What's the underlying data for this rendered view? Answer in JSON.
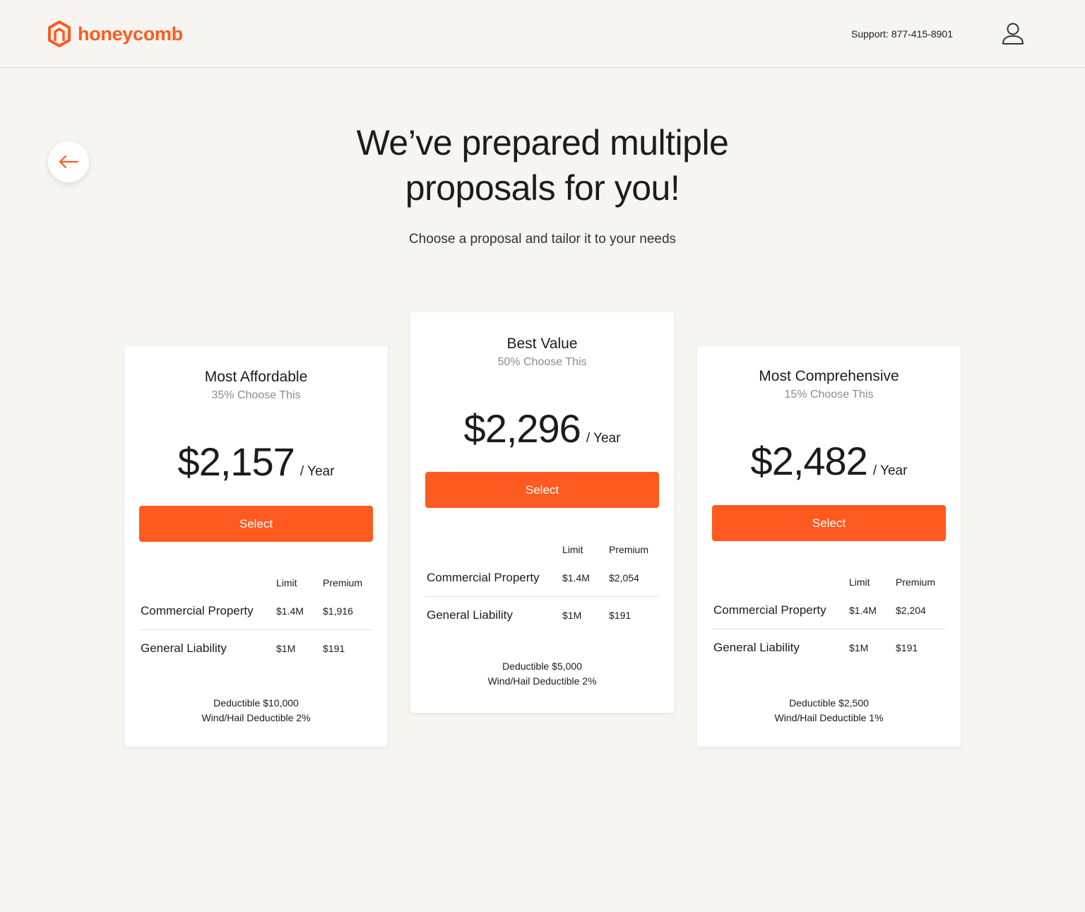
{
  "header": {
    "brand": "honeycomb",
    "support": "Support: 877-415-8901",
    "brand_color": "#ff5a1f"
  },
  "hero": {
    "title_line1": "We’ve prepared multiple",
    "title_line2": "proposals for you!",
    "subtitle": "Choose a proposal and tailor it to your needs"
  },
  "columns": {
    "limit": "Limit",
    "premium": "Premium"
  },
  "proposals": [
    {
      "name": "Most Affordable",
      "pct": "35% Choose This",
      "price": "$2,157",
      "per": "/ Year",
      "button": "Select",
      "rows": [
        {
          "name": "Commercial Property",
          "limit": "$1.4M",
          "premium": "$1,916"
        },
        {
          "name": "General Liability",
          "limit": "$1M",
          "premium": "$191"
        }
      ],
      "deductible": "Deductible $10,000",
      "wind": "Wind/Hail Deductible 2%"
    },
    {
      "name": "Best Value",
      "pct": "50% Choose This",
      "price": "$2,296",
      "per": "/ Year",
      "button": "Select",
      "rows": [
        {
          "name": "Commercial Property",
          "limit": "$1.4M",
          "premium": "$2,054"
        },
        {
          "name": "General Liability",
          "limit": "$1M",
          "premium": "$191"
        }
      ],
      "deductible": "Deductible $5,000",
      "wind": "Wind/Hail Deductible 2%"
    },
    {
      "name": "Most Comprehensive",
      "pct": "15% Choose This",
      "price": "$2,482",
      "per": "/ Year",
      "button": "Select",
      "rows": [
        {
          "name": "Commercial Property",
          "limit": "$1.4M",
          "premium": "$2,204"
        },
        {
          "name": "General Liability",
          "limit": "$1M",
          "premium": "$191"
        }
      ],
      "deductible": "Deductible $2,500",
      "wind": "Wind/Hail Deductible 1%"
    }
  ]
}
